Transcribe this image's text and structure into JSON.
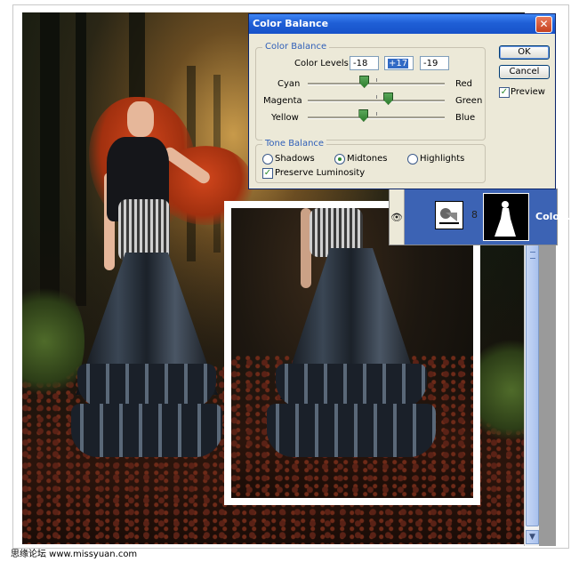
{
  "dialog": {
    "title": "Color Balance",
    "close_glyph": "✕",
    "color_balance_group": "Color Balance",
    "color_levels_label": "Color Levels:",
    "levels": [
      "-18",
      "+17",
      "-19"
    ],
    "sliders": [
      {
        "left": "Cyan",
        "right": "Red",
        "value": -18
      },
      {
        "left": "Magenta",
        "right": "Green",
        "value": 17
      },
      {
        "left": "Yellow",
        "right": "Blue",
        "value": -19
      }
    ],
    "tone_balance_group": "Tone Balance",
    "tones": [
      {
        "label": "Shadows",
        "selected": false
      },
      {
        "label": "Midtones",
        "selected": true
      },
      {
        "label": "Highlights",
        "selected": false
      }
    ],
    "preserve_luminosity_label": "Preserve Luminosity",
    "preserve_luminosity": true,
    "ok_label": "OK",
    "cancel_label": "Cancel",
    "preview_label": "Preview",
    "preview": true,
    "check_glyph": "✓"
  },
  "layers": {
    "eye_glyph": "👁",
    "chain_glyph": "8",
    "layer_name": "Colo..."
  },
  "scroll": {
    "up_glyph": "▼"
  },
  "footer": {
    "text": "思缘论坛  www.missyuan.com"
  },
  "colors": {
    "titlebar": "#1f5fd6",
    "selection": "#3c63b4",
    "legend_text": "#2f5fb8"
  }
}
